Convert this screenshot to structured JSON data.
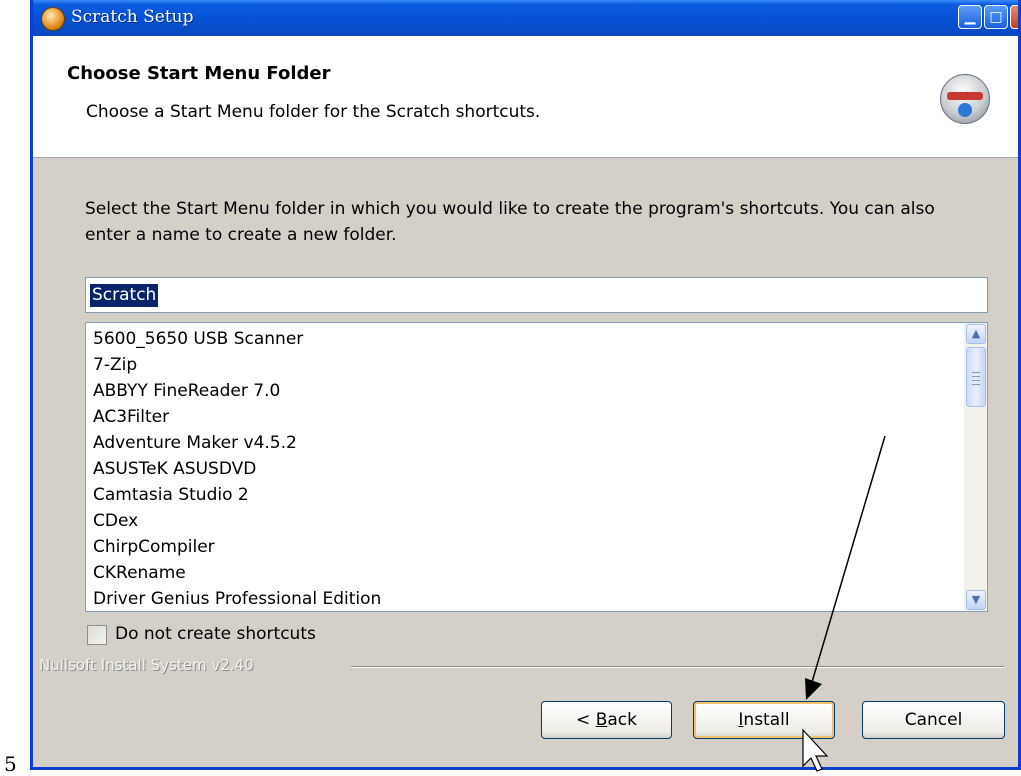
{
  "window": {
    "title": "Scratch Setup",
    "controls": {
      "minimize": "▁",
      "maximize": "□",
      "close": "✕"
    }
  },
  "header": {
    "title": "Choose Start Menu Folder",
    "subtitle": "Choose a Start Menu folder for the Scratch shortcuts."
  },
  "instruction": "Select the Start Menu folder in which you would like to create the program's shortcuts. You can also enter a name to create a new folder.",
  "folder_input": {
    "value": "Scratch"
  },
  "folder_list": [
    "5600_5650 USB Scanner",
    "7-Zip",
    "ABBYY FineReader 7.0",
    "AC3Filter",
    "Adventure Maker v4.5.2",
    "ASUSTeK ASUSDVD",
    "Camtasia Studio 2",
    "CDex",
    "ChirpCompiler",
    "CKRename",
    "Driver Genius Professional Edition"
  ],
  "checkbox": {
    "label": "Do not create shortcuts",
    "checked": false
  },
  "branding": "Nullsoft Install System v2.40",
  "buttons": {
    "back_prefix": "< ",
    "back_key": "B",
    "back_rest": "ack",
    "install_key": "I",
    "install_rest": "nstall",
    "cancel": "Cancel"
  },
  "stray_text": "5",
  "colors": {
    "title_bar": "#0551d4",
    "selection": "#0a246a",
    "dialog_bg": "#d4d0c8"
  },
  "icons": [
    "scratch-setup-icon",
    "installer-disk-icon",
    "scroll-up-icon",
    "scroll-down-icon",
    "annotation-arrow",
    "mouse-cursor-icon"
  ]
}
